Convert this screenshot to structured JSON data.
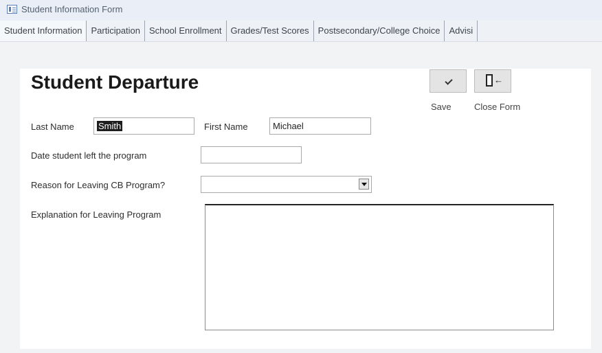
{
  "window": {
    "title": "Student Information Form"
  },
  "tabs": [
    {
      "label": "Student Information"
    },
    {
      "label": "Participation"
    },
    {
      "label": "School Enrollment"
    },
    {
      "label": "Grades/Test Scores"
    },
    {
      "label": "Postsecondary/College Choice"
    },
    {
      "label": "Advisi"
    }
  ],
  "form": {
    "heading": "Student Departure",
    "save_button": {
      "caption": "Save",
      "icon": "check-icon"
    },
    "close_button": {
      "caption": "Close Form",
      "icon": "exit-door-icon",
      "arrow_glyph": "←"
    },
    "fields": {
      "last_name": {
        "label": "Last Name",
        "value": "Smith"
      },
      "first_name": {
        "label": "First Name",
        "value": "Michael"
      },
      "date_left": {
        "label": "Date student left the program",
        "value": ""
      },
      "reason": {
        "label": "Reason for Leaving CB Program?",
        "value": ""
      },
      "explanation": {
        "label": "Explanation for Leaving Program",
        "value": ""
      }
    }
  }
}
